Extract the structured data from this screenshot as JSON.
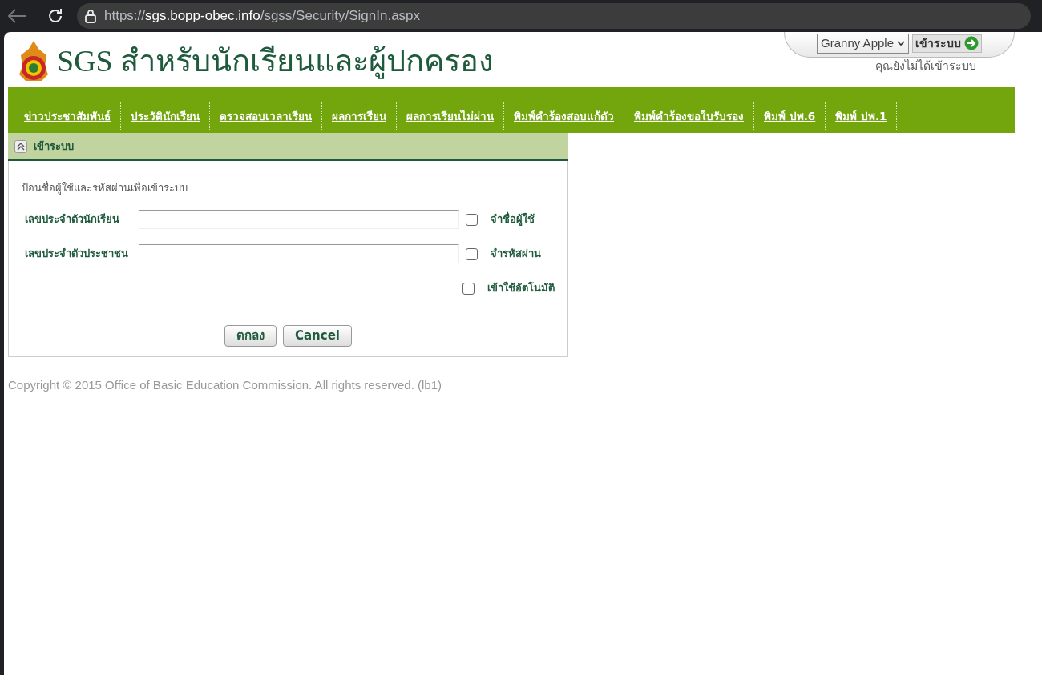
{
  "browser": {
    "url_host": "sgs.bopp-obec.info",
    "url_scheme": "https://",
    "url_path": "/sgss/Security/SignIn.aspx"
  },
  "header": {
    "title": "SGS สำหรับนักเรียนและผู้ปกครอง",
    "user_select": "Granny Apple",
    "login_button": "เข้าระบบ",
    "status": "คุณยังไม่ได้เข้าระบบ"
  },
  "menu": [
    {
      "label": "ข่าวประชาสัมพันธ์"
    },
    {
      "label": "ประวัตินักเรียน"
    },
    {
      "label": "ตรวจสอบเวลาเรียน"
    },
    {
      "label": "ผลการเรียน"
    },
    {
      "label": "ผลการเรียนไม่ผ่าน"
    },
    {
      "label": "พิมพ์คำร้องสอบแก้ตัว"
    },
    {
      "label": "พิมพ์คำร้องขอใบรับรอง"
    },
    {
      "label": "พิมพ์ ปพ.6"
    },
    {
      "label": "พิมพ์ ปพ.1"
    }
  ],
  "login_panel": {
    "title": "เข้าระบบ",
    "expanded": true,
    "instruction": "ป้อนชื่อผู้ใช้และรหัสผ่านเพื่อเข้าระบบ",
    "rows": [
      {
        "label": "เลขประจำตัวนักเรียน",
        "value": "",
        "checkbox": "จำชื่อผู้ใช้",
        "checked": false
      },
      {
        "label": "เลขประจำตัวประชาชน",
        "value": "",
        "checkbox": "จำรหัสผ่าน",
        "checked": false
      },
      {
        "checkbox": "เข้าใช้อัตโนมัติ",
        "checked": false
      }
    ],
    "buttons": [
      "ตกลง",
      "Cancel"
    ]
  },
  "footer": "Copyright © 2015 Office of Basic Education Commission. All rights reserved. (lb1)"
}
